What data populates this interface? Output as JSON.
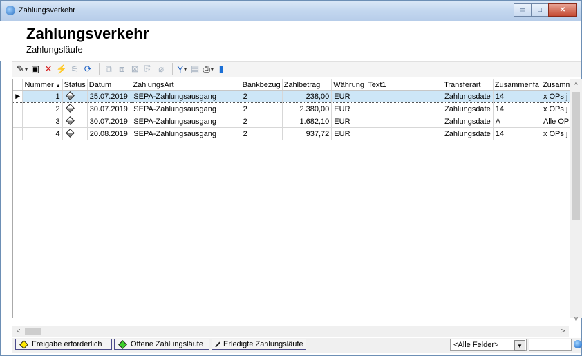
{
  "window": {
    "title": "Zahlungsverkehr",
    "buttons": {
      "minimize": "▭",
      "maximize": "□",
      "close": "✕"
    }
  },
  "header": {
    "title": "Zahlungsverkehr",
    "subtitle": "Zahlungsläufe"
  },
  "toolbar": {
    "items": [
      {
        "icon": "new-wand-icon",
        "glyph": "✎",
        "dropdown": true,
        "enabled": true
      },
      {
        "icon": "edit-record-icon",
        "glyph": "▣",
        "enabled": true
      },
      {
        "icon": "delete-icon",
        "glyph": "✕",
        "enabled": true,
        "color": "#d62020"
      },
      {
        "icon": "filter-run-icon",
        "glyph": "⚡",
        "enabled": false
      },
      {
        "icon": "split-icon",
        "glyph": "⚟",
        "enabled": false
      },
      {
        "icon": "refresh-icon",
        "glyph": "⟳",
        "enabled": true,
        "color": "#1a5fc4"
      },
      {
        "icon": "export-icon",
        "glyph": "⧉",
        "enabled": false
      },
      {
        "icon": "import-icon",
        "glyph": "⧈",
        "enabled": false
      },
      {
        "icon": "cancel-doc-icon",
        "glyph": "⊠",
        "enabled": false
      },
      {
        "icon": "copy-icon",
        "glyph": "⎘",
        "enabled": false
      },
      {
        "icon": "eraser-icon",
        "glyph": "⌀",
        "enabled": false
      },
      {
        "icon": "filter-icon",
        "glyph": "Y",
        "dropdown": true,
        "enabled": true,
        "color": "#1a5fc4"
      },
      {
        "icon": "document-icon",
        "glyph": "▤",
        "enabled": false
      },
      {
        "icon": "print-icon",
        "glyph": "⎙",
        "dropdown": true,
        "enabled": true
      },
      {
        "icon": "book-icon",
        "glyph": "▮",
        "enabled": true,
        "color": "#1a6fd6"
      }
    ]
  },
  "grid": {
    "columns": [
      "Nummer",
      "Status",
      "Datum",
      "ZahlungsArt",
      "Bankbezug",
      "Zahlbetrag",
      "Währung",
      "Text1",
      "Transferart",
      "Zusammenfa",
      "Zusamm"
    ],
    "sort_indicator": "▲",
    "rows": [
      {
        "nummer": "1",
        "datum": "25.07.2019",
        "art": "SEPA-Zahlungsausgang",
        "bankbezug": "2",
        "betrag": "238,00",
        "waehrung": "EUR",
        "text1": "",
        "transferart": "Zahlungsdate",
        "zusammenfa": "14",
        "zusamm": "x OPs j"
      },
      {
        "nummer": "2",
        "datum": "30.07.2019",
        "art": "SEPA-Zahlungsausgang",
        "bankbezug": "2",
        "betrag": "2.380,00",
        "waehrung": "EUR",
        "text1": "",
        "transferart": "Zahlungsdate",
        "zusammenfa": "14",
        "zusamm": "x OPs j"
      },
      {
        "nummer": "3",
        "datum": "30.07.2019",
        "art": "SEPA-Zahlungsausgang",
        "bankbezug": "2",
        "betrag": "1.682,10",
        "waehrung": "EUR",
        "text1": "",
        "transferart": "Zahlungsdate",
        "zusammenfa": "A",
        "zusamm": "Alle OP"
      },
      {
        "nummer": "4",
        "datum": "20.08.2019",
        "art": "SEPA-Zahlungsausgang",
        "bankbezug": "2",
        "betrag": "937,72",
        "waehrung": "EUR",
        "text1": "",
        "transferart": "Zahlungsdate",
        "zusammenfa": "14",
        "zusamm": "x OPs j"
      }
    ]
  },
  "statusbar": {
    "filters": [
      {
        "label": "Freigabe erforderlich",
        "color": "#ffe800"
      },
      {
        "label": "Offene Zahlungsläufe",
        "color": "#3ccf2a"
      },
      {
        "label": "Erledigte Zahlungsläufe",
        "color": "#9a9a9a"
      }
    ],
    "field_select": "<Alle Felder>",
    "search_value": ""
  }
}
